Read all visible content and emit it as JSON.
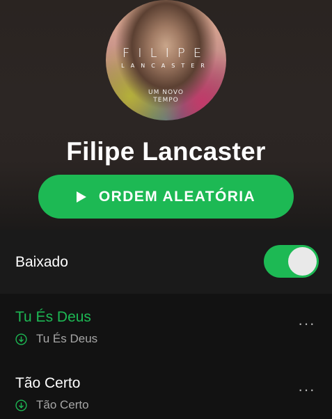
{
  "cover": {
    "name_line1": "FILIPE",
    "name_line2": "LANCASTER",
    "subtitle_line1": "UM NOVO",
    "subtitle_line2": "TEMPO"
  },
  "artist": {
    "name": "Filipe Lancaster"
  },
  "shuffle_button": {
    "label": "ORDEM ALEATÓRIA"
  },
  "downloaded": {
    "label": "Baixado",
    "enabled": true
  },
  "tracks": [
    {
      "title": "Tu És Deus",
      "artist": "Tu És Deus",
      "playing": true,
      "more": "···"
    },
    {
      "title": "Tão Certo",
      "artist": "Tão Certo",
      "playing": false,
      "more": "···"
    }
  ],
  "colors": {
    "accent": "#1db954",
    "background": "#121212",
    "secondary_text": "#a7a7a7"
  }
}
